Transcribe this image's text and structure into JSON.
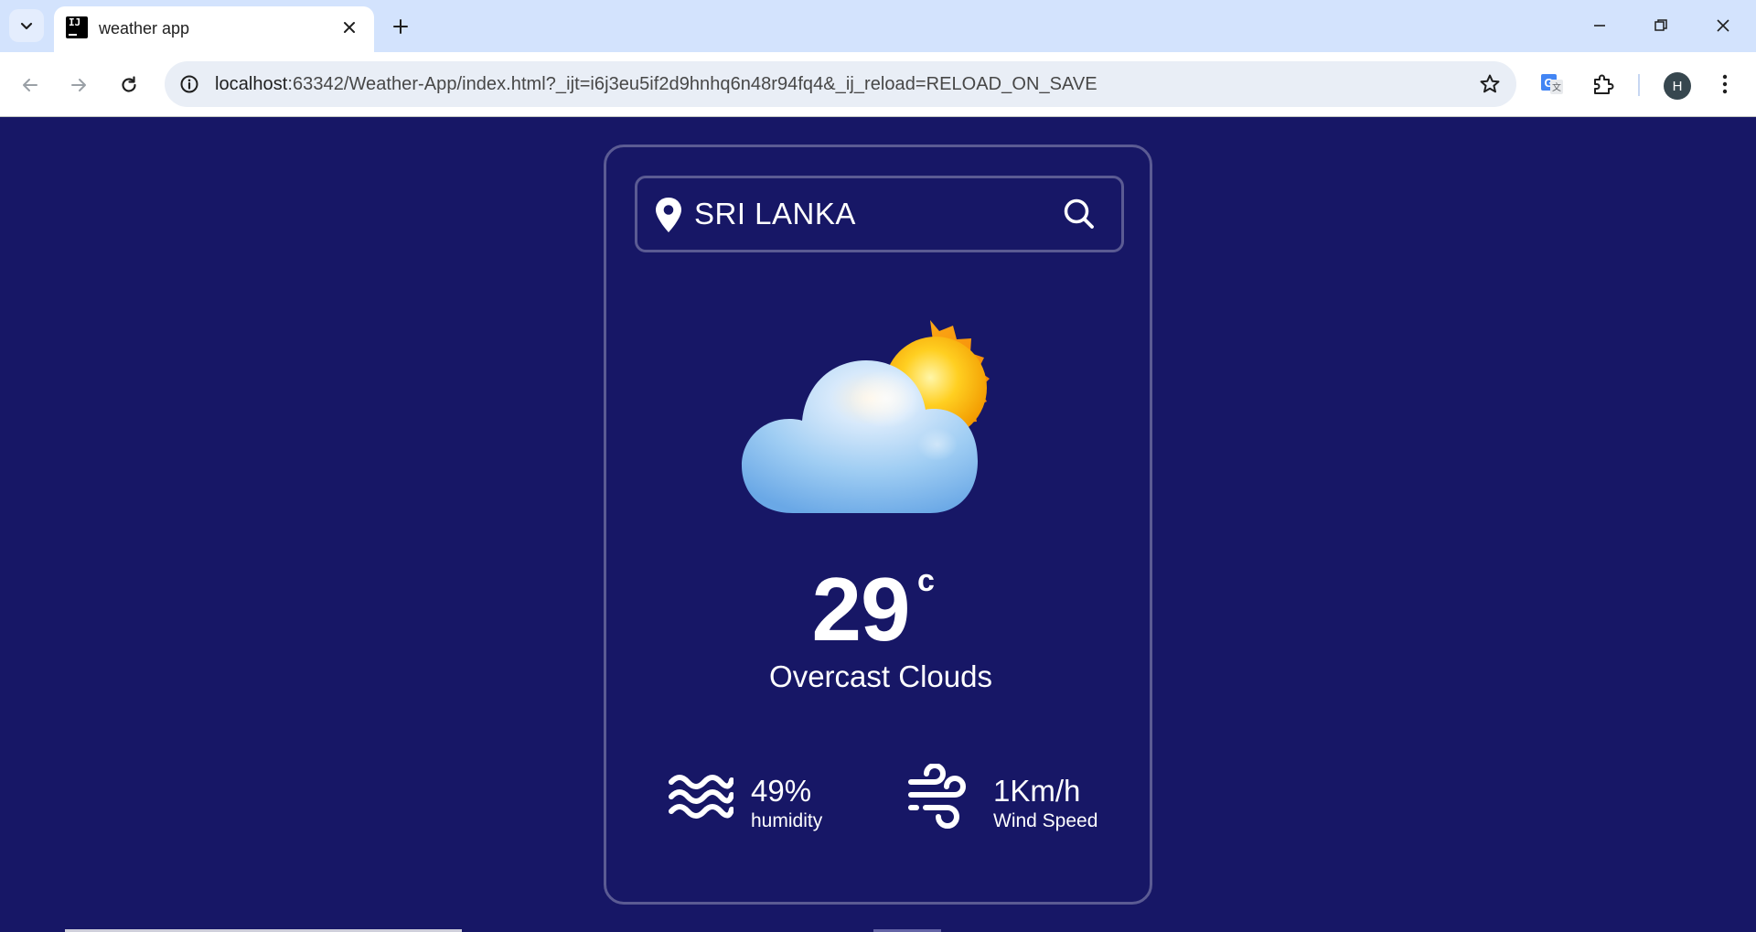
{
  "browser": {
    "tab": {
      "title": "weather app"
    },
    "omnibox": {
      "url_host": "localhost",
      "url_rest": ":63342/Weather-App/index.html?_ijt=i6j3eu5if2d9hnhq6n48r94fq4&_ij_reload=RELOAD_ON_SAVE"
    },
    "profile_initial": "H",
    "icons": {
      "tab_search": "chevron-down-icon",
      "new_tab": "plus-icon",
      "back": "arrow-left-icon",
      "forward": "arrow-right-icon",
      "reload": "reload-icon",
      "site_info": "info-icon",
      "bookmark": "star-icon",
      "translate": "google-translate-icon",
      "extensions": "puzzle-icon",
      "menu": "kebab-menu-icon"
    }
  },
  "weather": {
    "search": {
      "value": "SRI LANKA",
      "placeholder": ""
    },
    "temperature": "29",
    "unit": "c",
    "condition": "Overcast Clouds",
    "humidity": {
      "value": "49%",
      "label": "humidity"
    },
    "wind": {
      "value": "1Km/h",
      "label": "Wind Speed"
    }
  },
  "colors": {
    "page_bg": "#171766",
    "card_border": "#5b5b93",
    "text": "#ffffff",
    "chrome_tabstrip": "#d3e3fd",
    "omnibox_bg": "#e9eef6"
  }
}
